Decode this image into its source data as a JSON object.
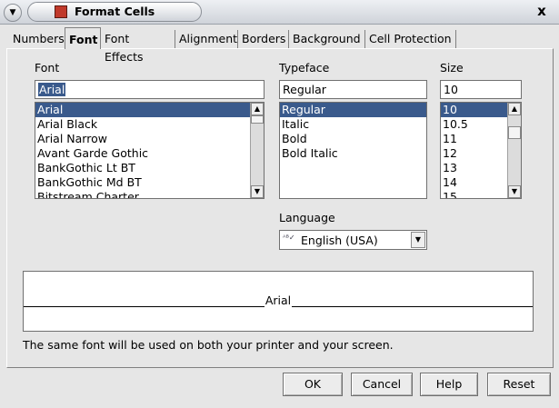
{
  "window": {
    "title": "Format Cells",
    "close_label": "x"
  },
  "tabs": [
    {
      "label": "Numbers"
    },
    {
      "label": "Font"
    },
    {
      "label": "Font Effects"
    },
    {
      "label": "Alignment"
    },
    {
      "label": "Borders"
    },
    {
      "label": "Background"
    },
    {
      "label": "Cell Protection"
    }
  ],
  "font": {
    "label": "Font",
    "value": "Arial",
    "items": [
      "Arial",
      "Arial Black",
      "Arial Narrow",
      "Avant Garde Gothic",
      "BankGothic Lt BT",
      "BankGothic Md BT",
      "Bitstream Charter"
    ]
  },
  "typeface": {
    "label": "Typeface",
    "value": "Regular",
    "items": [
      "Regular",
      "Italic",
      "Bold",
      "Bold Italic"
    ]
  },
  "size": {
    "label": "Size",
    "value": "10",
    "items": [
      "10",
      "10.5",
      "11",
      "12",
      "13",
      "14",
      "15"
    ]
  },
  "language": {
    "label": "Language",
    "value": "English (USA)",
    "icon": "spellcheck-icon"
  },
  "preview": {
    "text": "Arial"
  },
  "note": "The same font will be used on both your printer and your screen.",
  "buttons": {
    "ok": "OK",
    "cancel": "Cancel",
    "help": "Help",
    "reset": "Reset"
  },
  "colors": {
    "selection": "#3a5a8c",
    "dialog_bg": "#e6e6e6"
  }
}
